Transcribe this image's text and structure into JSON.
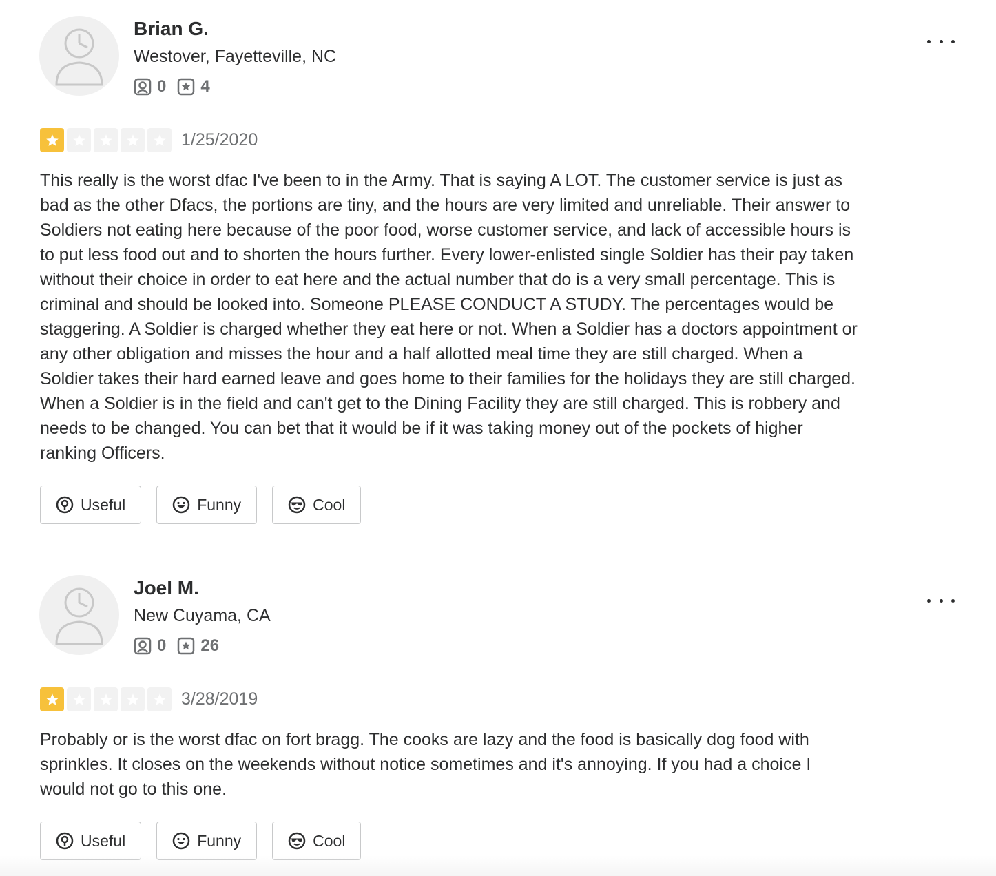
{
  "reviews": [
    {
      "user": {
        "name": "Brian G.",
        "location": "Westover, Fayetteville, NC",
        "friends": "0",
        "reviews": "4"
      },
      "rating": 1,
      "date": "1/25/2020",
      "text": "This really is the worst dfac I've been to in the Army. That is saying A LOT. The customer service is just as bad as the other Dfacs, the portions are tiny, and the hours are very limited and unreliable. Their answer to Soldiers not eating here because of the poor food, worse customer service, and lack of accessible hours is to put less food out and to shorten the hours further. Every lower-enlisted single Soldier has their pay taken without their choice in order to eat here and the actual number that do is a very small percentage. This is criminal and should be looked into. Someone PLEASE CONDUCT A STUDY. The percentages would be staggering. A Soldier is charged whether they eat here or not. When a Soldier has a doctors appointment or any other obligation and misses the hour and a half allotted meal time they are still charged. When a Soldier takes their hard earned leave and goes home to their families for the holidays they are still charged. When a Soldier is in the field and can't get to the Dining Facility they are still charged. This is robbery and needs to be changed. You can bet that it would be if it was taking money out of the pockets of higher ranking Officers.",
      "actions": {
        "useful": "Useful",
        "funny": "Funny",
        "cool": "Cool"
      }
    },
    {
      "user": {
        "name": "Joel M.",
        "location": "New Cuyama, CA",
        "friends": "0",
        "reviews": "26"
      },
      "rating": 1,
      "date": "3/28/2019",
      "text": "Probably or is the worst dfac on fort bragg. The cooks are lazy and the food is basically dog food with sprinkles. It closes on the weekends without notice sometimes and it's annoying. If you had a choice I would not go to this one.",
      "actions": {
        "useful": "Useful",
        "funny": "Funny",
        "cool": "Cool"
      }
    }
  ],
  "colors": {
    "star_filled": "#f7c13b",
    "star_empty": "#f2f2f2",
    "text": "#2d2e2f",
    "muted": "#6e7072"
  },
  "icons": {
    "avatar": "default-avatar-icon",
    "friends": "friends-icon",
    "review_count": "review-count-icon",
    "more": "more-options-icon",
    "useful": "lightbulb-icon",
    "funny": "smile-icon",
    "cool": "sunglasses-icon"
  }
}
